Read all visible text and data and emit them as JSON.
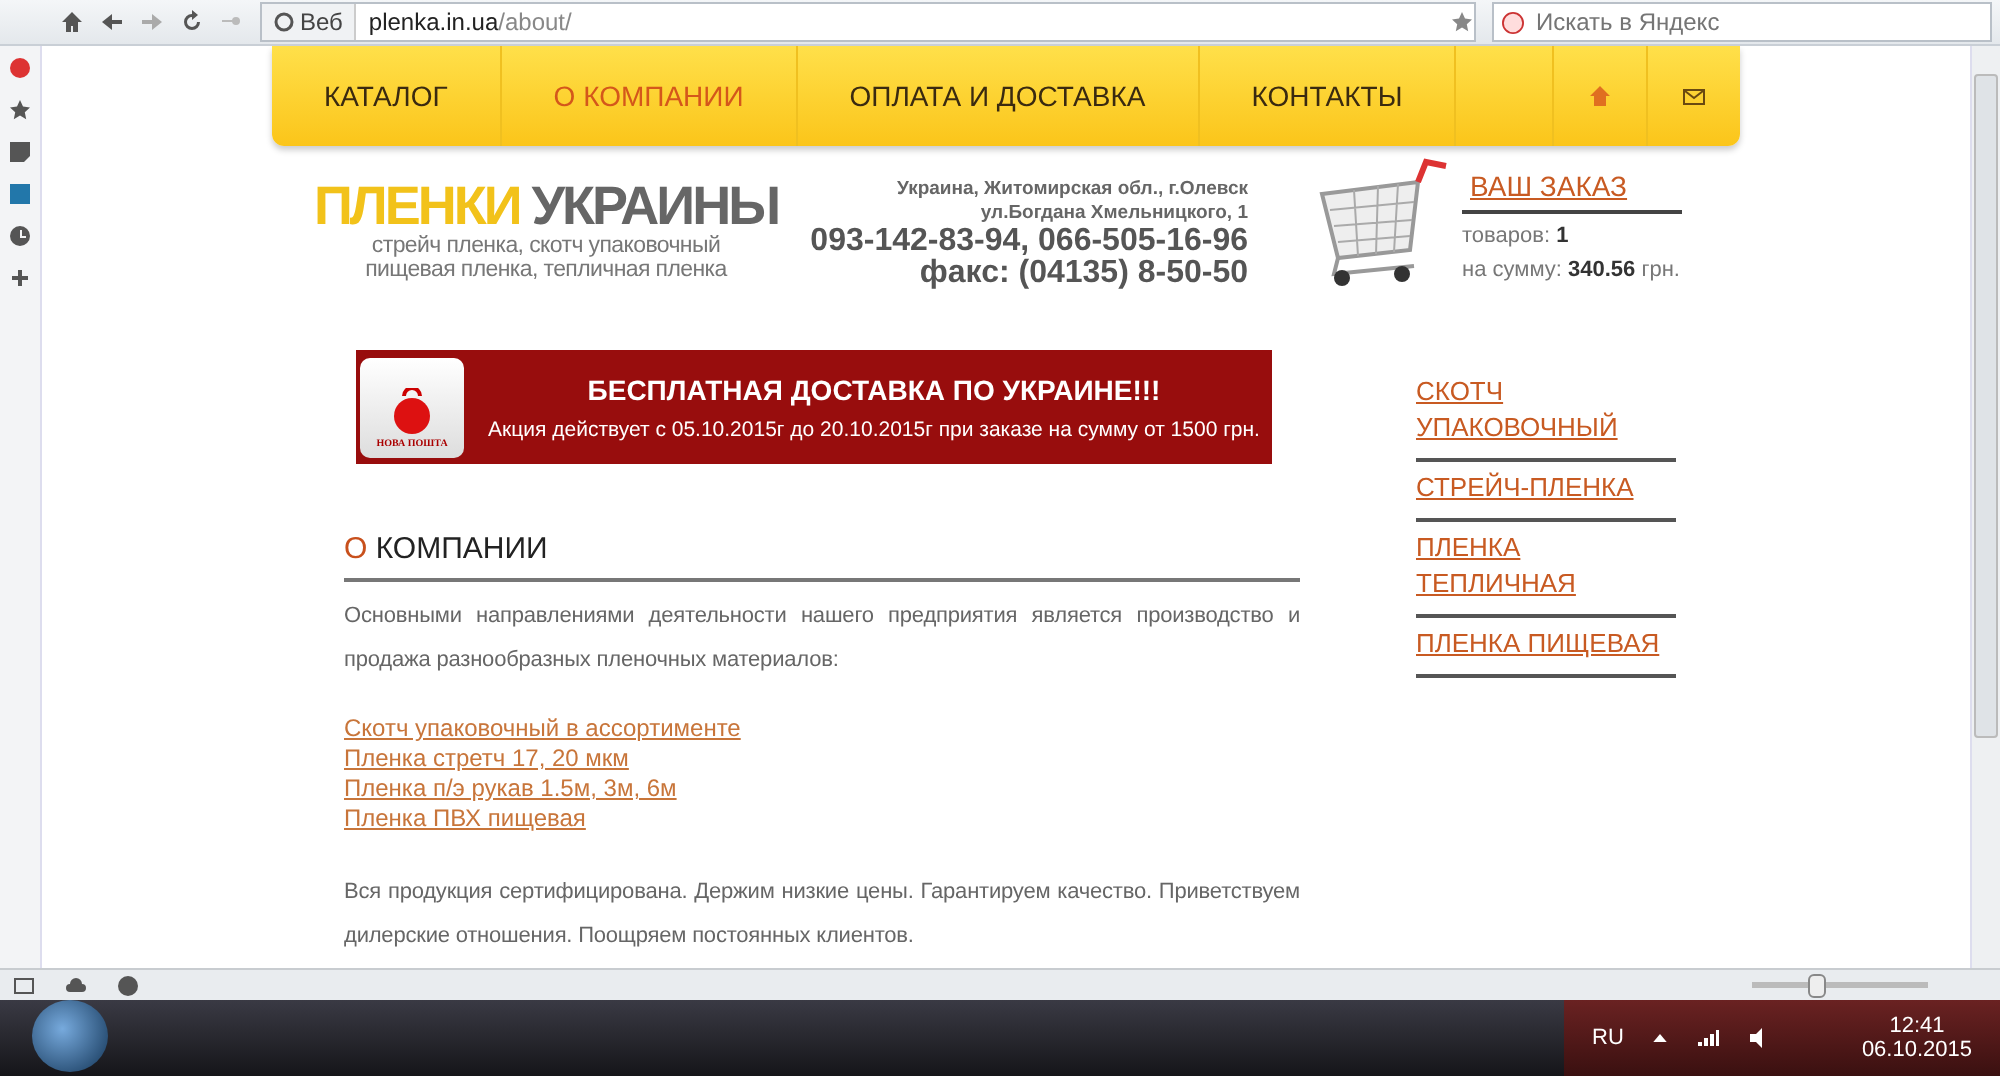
{
  "browser": {
    "address_label": "Веб",
    "url_host": "plenka.in.ua",
    "url_path": "/about/",
    "search_placeholder": "Искать в Яндекс"
  },
  "nav": [
    {
      "label": "КАТАЛОГ",
      "selected": false
    },
    {
      "label": "О КОМПАНИИ",
      "selected": true
    },
    {
      "label": "ОПЛАТА И ДОСТАВКА",
      "selected": false
    },
    {
      "label": "КОНТАКТЫ",
      "selected": false
    }
  ],
  "logo": {
    "part1": "ПЛЕНКИ",
    "part2": "УКРАИНЫ",
    "tagline1": "стрейч пленка, скотч упаковочный",
    "tagline2": "пищевая пленка, тепличная пленка"
  },
  "contacts": {
    "address1": "Украина, Житомирская обл., г.Олевск",
    "address2": "ул.Богдана Хмельницкого, 1",
    "phones": "093-142-83-94, 066-505-16-96",
    "fax": "факс: (04135) 8-50-50"
  },
  "cart": {
    "title": "ВАШ ЗАКАЗ",
    "items_label": "товаров:",
    "items_value": "1",
    "sum_label": "на сумму:",
    "sum_value": "340.56",
    "currency": "грн."
  },
  "banner": {
    "logo_text": "НОВА ПОШТА",
    "title": "БЕСПЛАТНАЯ ДОСТАВКА ПО УКРАИНЕ!!!",
    "text": "Акция действует с 05.10.2015г до 20.10.2015г при заказе на сумму от 1500 грн."
  },
  "article": {
    "title_first": "О",
    "title_rest": "КОМПАНИИ",
    "intro": "Основными направлениями деятельности нашего предприятия является производство и продажа разнообразных пленочных материалов:",
    "links": [
      "Скотч упаковочный в ассортименте",
      "Пленка стретч 17, 20 мкм",
      "Пленка п/э рукав 1.5м, 3м, 6м",
      "Пленка ПВХ пищевая"
    ],
    "outro": "Вся продукция сертифицирована. Держим низкие цены. Гарантируем качество. Приветствуем дилерские отношения. Поощряем постоянных клиентов."
  },
  "categories": [
    "СКОТЧ УПАКОВОЧНЫЙ",
    "СТРЕЙЧ-ПЛЕНКА",
    "ПЛЕНКА ТЕПЛИЧНАЯ",
    "ПЛЕНКА ПИЩЕВАЯ"
  ],
  "status_bar": {
    "zoom": {
      "level": 0.35
    }
  },
  "taskbar": {
    "language": "RU",
    "time": "12:41",
    "date": "06.10.2015"
  }
}
